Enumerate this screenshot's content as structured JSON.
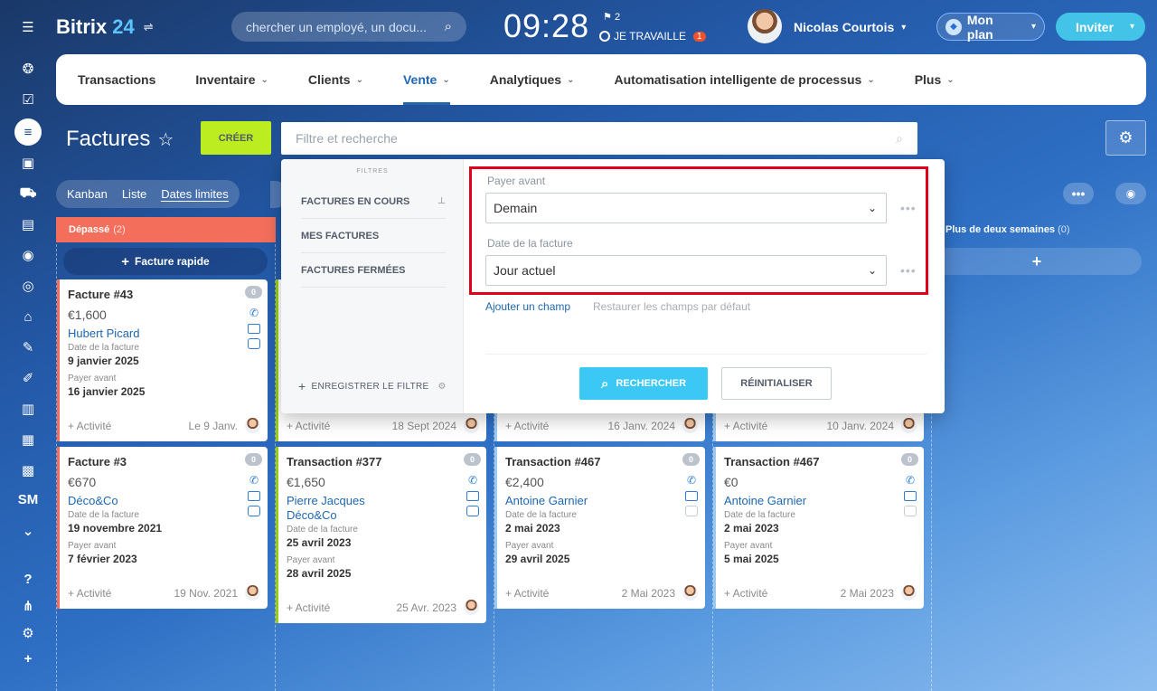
{
  "brand": {
    "name": "Bitrix",
    "num": "24"
  },
  "search_placeholder": "chercher un employé, un docu...",
  "clock": "09:28",
  "flag_count": "2",
  "work_status": "JE TRAVAILLE",
  "work_badge": "1",
  "user_name": "Nicolas Courtois",
  "plan_label": "Mon plan",
  "invite_label": "Inviter",
  "sidebar_sm": "SM",
  "nav": [
    {
      "label": "Transactions"
    },
    {
      "label": "Inventaire"
    },
    {
      "label": "Clients"
    },
    {
      "label": "Vente"
    },
    {
      "label": "Analytiques"
    },
    {
      "label": "Automatisation intelligente de processus"
    },
    {
      "label": "Plus"
    }
  ],
  "page_title": "Factures",
  "create_label": "CRÉER",
  "filter_placeholder": "Filtre et recherche",
  "views": [
    "Kanban",
    "Liste",
    "Dates limites"
  ],
  "columns": {
    "overdue": {
      "name": "Dépassé",
      "count": "(2)"
    },
    "twoweeks": {
      "name": "Plus de deux semaines",
      "count": "(0)"
    }
  },
  "quick_invoice": "Facture rapide",
  "filter_panel": {
    "header": "FILTRES",
    "presets": [
      "FACTURES EN COURS",
      "MES FACTURES",
      "FACTURES FERMÉES"
    ],
    "save_label": "ENREGISTRER LE FILTRE",
    "field1_label": "Payer avant",
    "field1_value": "Demain",
    "field2_label": "Date de la facture",
    "field2_value": "Jour actuel",
    "add_field": "Ajouter un champ",
    "restore": "Restaurer les champs par défaut",
    "search_btn": "RECHERCHER",
    "reset_btn": "RÉINITIALISER"
  },
  "labels": {
    "inv_date": "Date de la facture",
    "pay_before": "Payer avant",
    "activity": "+ Activité"
  },
  "cards": [
    {
      "title": "Facture #43",
      "count": "0",
      "amount": "€1,600",
      "client": "Hubert Picard",
      "inv_date": "9 janvier 2025",
      "pay_before": "16 janvier 2025",
      "foot_date": "Le 9 Janv."
    },
    {
      "title": "Facture #3",
      "count": "0",
      "amount": "€670",
      "client": "Déco&Co",
      "inv_date": "19 novembre 2021",
      "pay_before": "7 février 2023",
      "foot_date": "19 Nov. 2021"
    },
    {
      "title": "Transaction #377",
      "count": "0",
      "amount": "€1,650",
      "client": "Pierre Jacques",
      "client2": "Déco&Co",
      "inv_date": "25 avril 2023",
      "pay_before": "28 avril 2025",
      "foot_date": "25 Avr. 2023"
    },
    {
      "title": "Transaction #467",
      "count": "0",
      "amount": "€2,400",
      "client": "Antoine Garnier",
      "inv_date": "2 mai 2023",
      "pay_before": "29 avril 2025",
      "foot_date": "2 Mai 2023"
    },
    {
      "title": "Transaction #467",
      "count": "0",
      "amount": "€0",
      "client": "Antoine Garnier",
      "inv_date": "2 mai 2023",
      "pay_before": "5 mai 2025",
      "foot_date": "2 Mai 2023"
    }
  ],
  "partial_feet": [
    {
      "date": "18 Sept 2024"
    },
    {
      "date": "16 Janv. 2024"
    },
    {
      "date": "10 Janv. 2024"
    }
  ]
}
